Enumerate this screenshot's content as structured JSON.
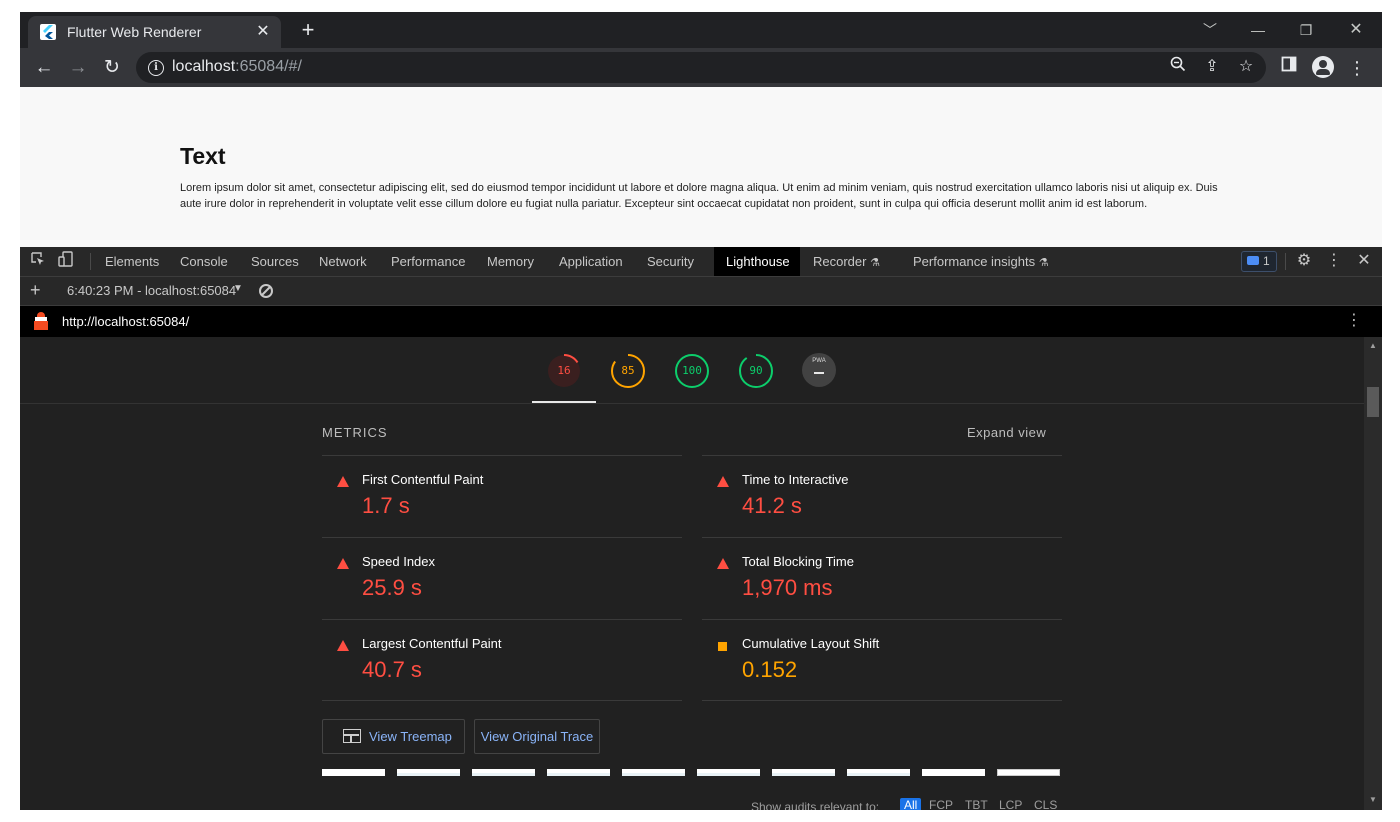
{
  "browser": {
    "tab_title": "Flutter Web Renderer",
    "close_tab": "✕",
    "new_tab": "+",
    "url_host": "localhost",
    "url_rest": ":65084/#/"
  },
  "page": {
    "heading": "Text",
    "paragraph": "Lorem ipsum dolor sit amet, consectetur adipiscing elit, sed do eiusmod tempor incididunt ut labore et dolore magna aliqua. Ut enim ad minim veniam, quis nostrud exercitation ullamco laboris nisi ut aliquip ex. Duis aute irure dolor in reprehenderit in voluptate velit esse cillum dolore eu fugiat nulla pariatur. Excepteur sint occaecat cupidatat non proident, sunt in culpa qui officia deserunt mollit anim id est laborum."
  },
  "devtools": {
    "tabs": [
      "Elements",
      "Console",
      "Sources",
      "Network",
      "Performance",
      "Memory",
      "Application",
      "Security",
      "Lighthouse",
      "Recorder",
      "Performance insights"
    ],
    "active_tab": "Lighthouse",
    "issues_count": "1",
    "report_label": "6:40:23 PM - localhost:65084",
    "report_url": "http://localhost:65084/"
  },
  "lighthouse": {
    "gauges": [
      {
        "label": "16",
        "score": 16,
        "color": "#ff4e42"
      },
      {
        "label": "85",
        "score": 85,
        "color": "#ffa400"
      },
      {
        "label": "100",
        "score": 100,
        "color": "#0cce6b"
      },
      {
        "label": "90",
        "score": 90,
        "color": "#0cce6b"
      }
    ],
    "pwa_label": "PWA",
    "metrics_heading": "METRICS",
    "expand_label": "Expand view",
    "metrics": [
      {
        "label": "First Contentful Paint",
        "value": "1.7 s",
        "status": "fail"
      },
      {
        "label": "Time to Interactive",
        "value": "41.2 s",
        "status": "fail"
      },
      {
        "label": "Speed Index",
        "value": "25.9 s",
        "status": "fail"
      },
      {
        "label": "Total Blocking Time",
        "value": "1,970 ms",
        "status": "fail"
      },
      {
        "label": "Largest Contentful Paint",
        "value": "40.7 s",
        "status": "fail"
      },
      {
        "label": "Cumulative Layout Shift",
        "value": "0.152",
        "status": "average"
      }
    ],
    "view_treemap": "View Treemap",
    "view_trace": "View Original Trace",
    "filter_label": "Show audits relevant to:",
    "filters": [
      "All",
      "FCP",
      "TBT",
      "LCP",
      "CLS"
    ]
  },
  "colors": {
    "fail": "#ff4e42",
    "average": "#ffa400",
    "pass": "#0cce6b",
    "link": "#8ab4f8"
  }
}
